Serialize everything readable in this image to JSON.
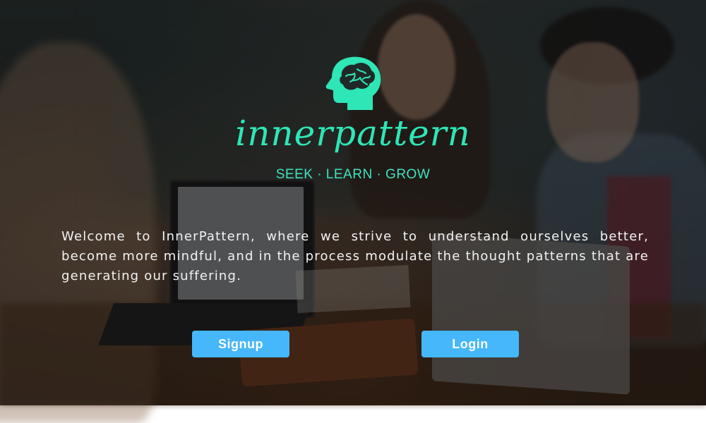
{
  "brand": {
    "name": "innerpattern",
    "tagline": "SEEK · LEARN · GROW",
    "accent_color": "#2ee6b6",
    "icon": "head-brain-icon"
  },
  "intro": {
    "text": "Welcome to InnerPattern, where we strive to understand ourselves better, become more mindful, and in the process modulate the thought patterns that are generating our suffering."
  },
  "actions": {
    "signup_label": "Signup",
    "login_label": "Login",
    "button_color": "#45b7fa"
  },
  "background": {
    "icon": "people-working-photo"
  }
}
